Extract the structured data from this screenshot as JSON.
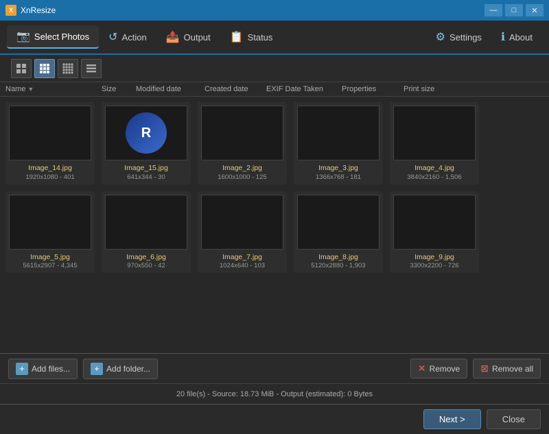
{
  "titleBar": {
    "appName": "XnResize",
    "iconLabel": "X",
    "minimizeLabel": "—",
    "maximizeLabel": "□",
    "closeLabel": "✕"
  },
  "menuBar": {
    "items": [
      {
        "id": "select-photos",
        "icon": "📷",
        "label": "Select Photos",
        "active": true
      },
      {
        "id": "action",
        "icon": "↺",
        "label": "Action",
        "active": false
      },
      {
        "id": "output",
        "icon": "📤",
        "label": "Output",
        "active": false
      },
      {
        "id": "status",
        "icon": "📋",
        "label": "Status",
        "active": false
      },
      {
        "id": "settings",
        "icon": "⚙",
        "label": "Settings",
        "active": false
      },
      {
        "id": "about",
        "icon": "ℹ",
        "label": "About",
        "active": false
      }
    ]
  },
  "toolbar": {
    "views": [
      {
        "id": "large-grid",
        "icon": "⊞",
        "active": false
      },
      {
        "id": "medium-grid",
        "icon": "⊞",
        "active": true
      },
      {
        "id": "small-grid",
        "icon": "⊞",
        "active": false
      },
      {
        "id": "list",
        "icon": "☰",
        "active": false
      }
    ]
  },
  "columnHeaders": [
    {
      "id": "name",
      "label": "Name",
      "hasSortArrow": true
    },
    {
      "id": "size",
      "label": "Size"
    },
    {
      "id": "modified",
      "label": "Modified date"
    },
    {
      "id": "created",
      "label": "Created date"
    },
    {
      "id": "exif",
      "label": "EXIF Date Taken"
    },
    {
      "id": "properties",
      "label": "Properties"
    },
    {
      "id": "printSize",
      "label": "Print size"
    }
  ],
  "images": [
    {
      "id": "img14",
      "name": "Image_14.jpg",
      "info": "1920x1080 - 401",
      "thumbClass": "thumb-waterfall"
    },
    {
      "id": "img15",
      "name": "Image_15.jpg",
      "info": "641x344 - 30",
      "thumbClass": "thumb-logo",
      "isLogo": true
    },
    {
      "id": "img2",
      "name": "Image_2.jpg",
      "info": "1600x1000 - 125",
      "thumbClass": "thumb-bridge"
    },
    {
      "id": "img3",
      "name": "Image_3.jpg",
      "info": "1366x768 - 181",
      "thumbClass": "thumb-cat"
    },
    {
      "id": "img4",
      "name": "Image_4.jpg",
      "info": "3840x2160 - 1,506",
      "thumbClass": "thumb-helicopter"
    },
    {
      "id": "img5",
      "name": "Image_5.jpg",
      "info": "5615x2907 - 4,345",
      "thumbClass": "thumb-lightning"
    },
    {
      "id": "img6",
      "name": "Image_6.jpg",
      "info": "970x550 - 42",
      "thumbClass": "thumb-bliss"
    },
    {
      "id": "img7",
      "name": "Image_7.jpg",
      "info": "1024x640 - 103",
      "thumbClass": "thumb-lake"
    },
    {
      "id": "img8",
      "name": "Image_8.jpg",
      "info": "5120x2880 - 1,903",
      "thumbClass": "thumb-sunset-mountain"
    },
    {
      "id": "img9",
      "name": "Image_9.jpg",
      "info": "3300x2200 - 726",
      "thumbClass": "thumb-clouds"
    }
  ],
  "actionBar": {
    "addFiles": "Add files...",
    "addFolder": "Add folder...",
    "remove": "Remove",
    "removeAll": "Remove all"
  },
  "statusBar": {
    "text": "20 file(s) - Source: 18.73 MiB - Output (estimated): 0 Bytes"
  },
  "navBar": {
    "next": "Next >",
    "close": "Close"
  }
}
